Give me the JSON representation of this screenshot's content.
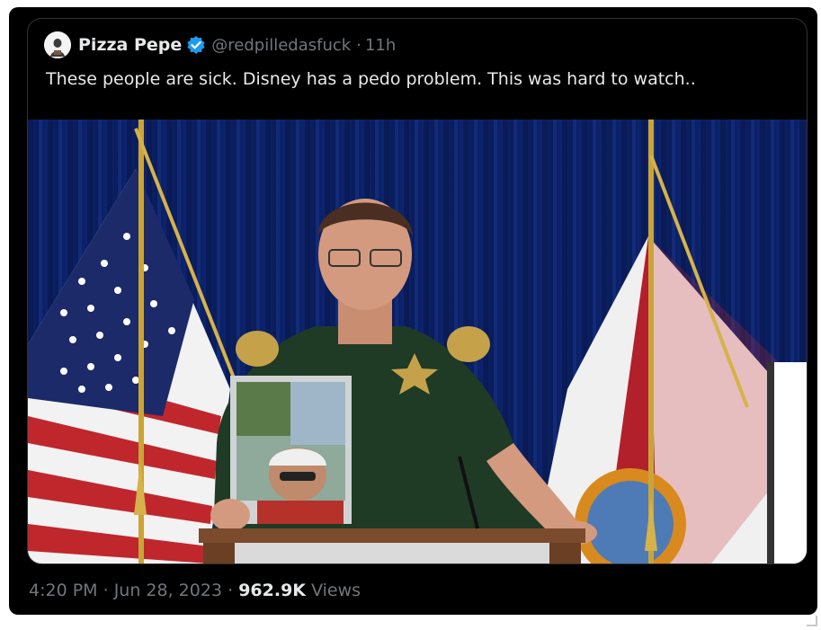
{
  "quoted_post": {
    "author_name": "Pizza Pepe",
    "handle": "@redpilledasfuck",
    "separator": "·",
    "time_ago": "11h",
    "text": "These people are sick. Disney has a pedo problem. This was hard to watch..",
    "verified": true
  },
  "post_meta": {
    "time": "4:20 PM",
    "dot1": "·",
    "date": "Jun 28, 2023",
    "dot2": "·",
    "views_count": "962.9K",
    "views_label": "Views"
  },
  "colors": {
    "background": "#000000",
    "text_primary": "#e7e9ea",
    "text_secondary": "#71767b",
    "verified_blue": "#1d9bf0",
    "curtain_blue": "#0a1d58"
  },
  "icons": {
    "verified": "verified-badge-icon",
    "avatar": "user-avatar"
  }
}
